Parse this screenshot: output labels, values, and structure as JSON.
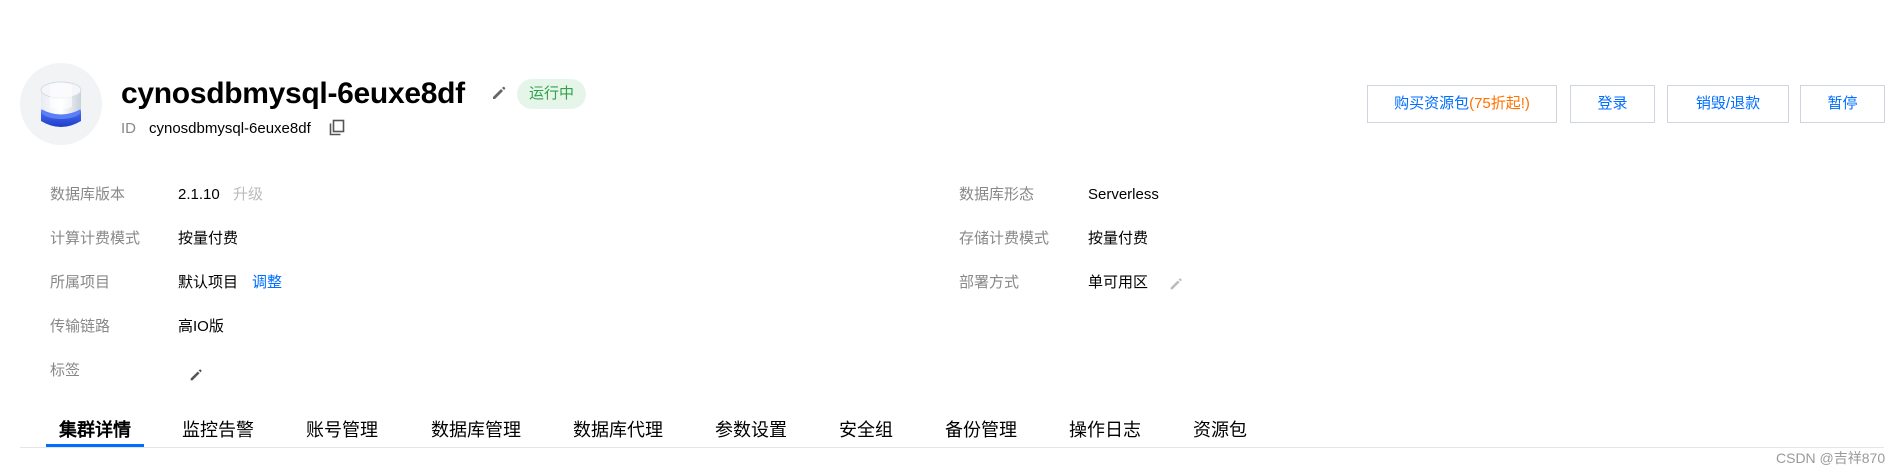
{
  "header": {
    "title": "cynosdbmysql-6euxe8df",
    "status": "运行中",
    "id_label": "ID",
    "id_value": "cynosdbmysql-6euxe8df"
  },
  "actions": {
    "buy_label": "购买资源包",
    "buy_promo": "(75折起!)",
    "login_label": "登录",
    "destroy_label": "销毁/退款",
    "pause_label": "暂停"
  },
  "info": {
    "db_version_label": "数据库版本",
    "db_version_value": "2.1.10",
    "upgrade_label": "升级",
    "compute_billing_label": "计算计费模式",
    "compute_billing_value": "按量付费",
    "project_label": "所属项目",
    "project_value": "默认项目",
    "adjust_label": "调整",
    "link_label": "传输链路",
    "link_value": "高IO版",
    "tags_label": "标签",
    "db_form_label": "数据库形态",
    "db_form_value": "Serverless",
    "storage_billing_label": "存储计费模式",
    "storage_billing_value": "按量付费",
    "deploy_label": "部署方式",
    "deploy_value": "单可用区"
  },
  "tabs": [
    "集群详情",
    "监控告警",
    "账号管理",
    "数据库管理",
    "数据库代理",
    "参数设置",
    "安全组",
    "备份管理",
    "操作日志",
    "资源包"
  ],
  "watermark": "CSDN @吉祥870",
  "colors": {
    "accent": "#006eff",
    "promo": "#ff7200",
    "status_text": "#2fa24a",
    "status_bg": "#e6f5ea"
  }
}
